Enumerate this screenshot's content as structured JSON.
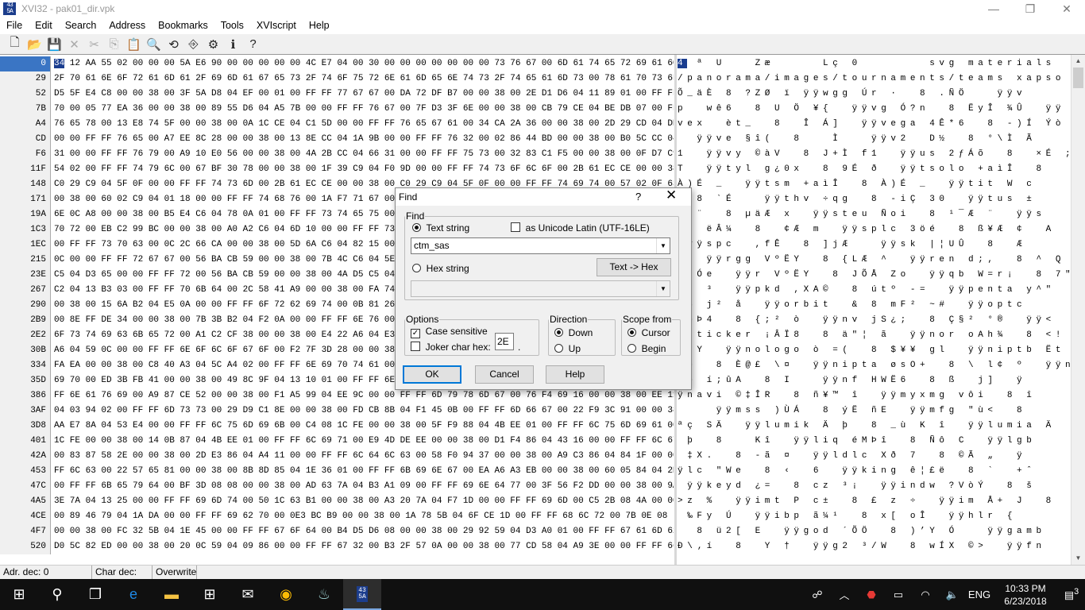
{
  "window": {
    "title": "XVI32 - pak01_dir.vpk",
    "icon_text": "4340\n5A5E\n4920",
    "minimize": "—",
    "restore": "❐",
    "close": "✕"
  },
  "menu": [
    "File",
    "Edit",
    "Search",
    "Address",
    "Bookmarks",
    "Tools",
    "XVIscript",
    "Help"
  ],
  "toolbar": [
    {
      "name": "new-file-icon",
      "glyph": "🗋"
    },
    {
      "name": "open-folder-icon",
      "glyph": "📂"
    },
    {
      "name": "save-icon",
      "glyph": "💾"
    },
    {
      "name": "close-file-icon",
      "glyph": "✕"
    },
    {
      "name": "cut-icon",
      "glyph": "✂"
    },
    {
      "name": "copy-icon",
      "glyph": "⎘"
    },
    {
      "name": "paste-icon",
      "glyph": "📋"
    },
    {
      "name": "find-icon",
      "glyph": "🔍"
    },
    {
      "name": "replace-icon",
      "glyph": "⟲"
    },
    {
      "name": "goto-icon",
      "glyph": "⎆"
    },
    {
      "name": "run-script-icon",
      "glyph": "⚙"
    },
    {
      "name": "about-icon",
      "glyph": "ℹ"
    },
    {
      "name": "context-help-icon",
      "glyph": "?"
    }
  ],
  "editor": {
    "addresses": [
      "0",
      "29",
      "52",
      "7B",
      "A4",
      "CD",
      "F6",
      "11F",
      "148",
      "171",
      "19A",
      "1C3",
      "1EC",
      "215",
      "23E",
      "267",
      "290",
      "2B9",
      "2E2",
      "30B",
      "334",
      "35D",
      "386",
      "3AF",
      "3D8",
      "401",
      "42A",
      "453",
      "47C",
      "4A5",
      "4CE",
      "4F7",
      "520"
    ],
    "hex_rows": [
      "34 12 AA 55 02 00 00 00 5A E6 90 00 00 00 00 00 4C E7 04 00 30 00 00 00 00 00 00 00 73 76 67 00 6D 61 74 65 72 69 61 6C 73",
      "2F 70 61 6E 6F 72 61 6D 61 2F 69 6D 61 67 65 73 2F 74 6F 75 72 6E 61 6D 65 6E 74 73 2F 74 65 61 6D 73 00 78 61 70 73 6F 00",
      "D5 5F E4 C8 00 00 38 00 3F 5A D8 04 EF 00 01 00 FF FF 77 67 67 00 DA 72 DF B7 00 00 38 00 2E D1 D6 04 11 89 01 00 FF FF 76",
      "70 00 05 77 EA 36 00 00 38 00 89 55 D6 04 A5 7B 00 00 FF FF 76 67 00 7F D3 3F 6E 00 00 38 00 CB 79 CE 04 BE DB 07 00 FF FF",
      "76 65 78 00 13 E8 74 5F 00 00 38 00 0A 1C CE 04 C1 5D 00 00 FF FF 76 65 67 61 00 34 CA 2A 36 00 00 38 00 2D 29 CD 04 DD F2",
      "00 00 FF FF 76 65 00 A7 EE 8C 28 00 00 38 00 13 8E CC 04 1A 9B 00 00 FF FF 76 32 00 02 86 44 BD 00 00 38 00 B0 5C CC 04 C3",
      "31 00 00 FF FF 76 79 00 A9 10 E0 56 00 00 38 00 4A 2B CC 04 66 31 00 00 FF FF 75 73 00 32 83 C1 F5 00 00 38 00 0F D7 C9 04 3B",
      "54 02 00 FF FF 74 79 6C 00 67 BF 30 78 00 00 38 00 1F 39 C9 04 F0 9D 00 00 FF FF 74 73 6F 6C 6F 00 2B 61 EC CE 00 00 38 00",
      "C0 29 C9 04 5F 0F 00 00 FF FF 74 73 6D 00 2B 61 EC CE 00 00 38 00 C0 29 C9 04 5F 0F 00 00 FF FF 74 69 74 00 57 02 0F 63 00",
      "00 38 00 60 02 C9 04 01 18 00 00 FF FF 74 68 76 00 1A F7 71 67 00 00 38 00 2D 69 C7 04 33 30 00 00 FF FF 74 75 73 00 B1 00",
      "6E 0C A8 00 00 38 00 B5 E4 C6 04 78 0A 01 00 FF FF 73 74 65 75 00 12 D1 6F 69 00 00 38 00 B9 AF C6 04 A8 1A 00 00 FF FF 73",
      "70 72 00 EB C2 99 BC 00 00 38 00 A0 A2 C6 04 6D 10 00 00 FF FF 73 70 6C 63 00 33 F6 E9 00 00 38 00 DF A5 C6 04 A2 00 00 41",
      "00 FF FF 73 70 63 00 0C 2C 66 CA 00 00 38 00 5D 6A C6 04 82 15 00 00 FF FF 73 6B 00 7C A6 55 DB 00 00 38 00 11 11 C6 04 95",
      "0C 00 00 FF FF 72 67 67 00 56 BA CB 59 00 00 38 00 7B 4C C6 04 5E 1A 00 00 FF FF 72 65 6E 00 64 3B 2C 00 00 38 00 5E 1E 51",
      "C5 04 D3 65 00 00 FF FF 72 00 56 BA CB 59 00 00 38 00 4A D5 C5 04 5A 6F 00 00 FF FF 71 62 00 57 3D 72 A1 00 00 38 00 37 22",
      "C2 04 13 B3 03 00 FF FF 70 6B 64 00 2C 58 41 A9 00 00 38 00 FA 74 BA 04 2D 3D 00 00 FF FF 70 65 6E 74 61 00 79 5E 22 00 00",
      "00 38 00 15 6A B2 04 E5 0A 00 00 FF FF 6F 72 62 69 74 00 0B 81 26 1D 00 00 38 00 6D 46 B2 04 7E 23 00 00 FF FF 6F 70 74 63",
      "00 8E FF DE 34 00 00 38 00 7B 3B B2 04 F2 0A 00 00 FF FF 6E 76 00 6A 53 BF 3B 00 00 38 00 C7 A7 B2 04 B0 AE 00 00 FF FF 3C",
      "6F 73 74 69 63 6B 65 72 00 A1 C2 CF 38 00 00 38 00 E4 22 A6 04 E3 9E 00 00 FF FF 6E 6F 72 00 6F 41 68 BE 00 00 38 00 3C 21",
      "A6 04 59 0C 00 00 FF FF 6E 6F 6C 6F 67 6F 00 F2 7F 3D 28 00 00 38 00 24 A5 A5 04 67 6C 00 00 FF FF 6E 69 70 74 62 00 CB 74",
      "FA EA 00 00 38 00 C8 40 A3 04 5C A4 02 00 FF FF 6E 69 70 74 61 00 F8 73 4F 2B 00 00 38 00 5C A0 6C A2 04 BA 00 00 FF FF 6E",
      "69 70 00 ED 3B FB 41 00 00 38 00 49 8C 9F 04 13 10 01 00 FF FF 6E 66 00 48 57 CB 36 00 00 38 00 DF 9A 9B 04 6A 5D 00 00 FF",
      "FF 6E 61 76 69 00 A9 87 CE 52 00 00 38 00 F1 A5 99 04 EE 9C 00 00 FF FF 6D 79 78 6D 67 00 76 F4 69 16 00 00 38 00 EE 11 97",
      "04 03 94 02 00 FF FF 6D 73 73 00 29 D9 C1 8E 00 00 38 00 FD CB 8B 04 F1 45 0B 00 FF FF 6D 66 67 00 22 F9 3C 91 00 00 38 00",
      "AA E7 8A 04 53 E4 00 00 FF FF 6C 75 6D 69 6B 00 C4 08 1C FE 00 00 38 00 5F F9 88 04 4B EE 01 00 FF FF 6C 75 6D 69 61 00 C4 08",
      "1C FE 00 00 38 00 14 0B 87 04 4B EE 01 00 FF FF 6C 69 71 00 E9 4D DE EE 00 00 38 00 D1 F4 86 04 43 16 00 00 FF FF 6C 67 62",
      "00 83 87 58 2E 00 00 38 00 2D E3 86 04 A4 11 00 00 FF FF 6C 64 6C 63 00 58 F0 94 37 00 00 38 00 A9 C3 86 04 84 1F 00 00 FF",
      "FF 6C 63 00 22 57 65 81 00 00 38 00 8B 8D 85 04 1E 36 01 00 FF FF 6B 69 6E 67 00 EA A6 A3 EB 00 00 38 00 60 05 84 04 2B 88",
      "00 FF FF 6B 65 79 64 00 BF 3D 08 08 00 00 38 00 AD 63 7A 04 B3 A1 09 00 FF FF 69 6E 64 77 00 3F 56 F2 DD 00 00 38 00 9A",
      "3E 7A 04 13 25 00 00 FF FF 69 6D 74 00 50 1C 63 B1 00 00 38 00 A3 20 7A 04 F7 1D 00 00 FF FF 69 6D 00 C5 2B 08 4A 00 00 38",
      "00 89 46 79 04 1A DA 00 00 FF FF 69 62 70 00 0E3 BC B9 00 00 38 00 1A 78 5B 04 6F CE 1D 00 FF FF 68 6C 72 00 7B 0E 08",
      "00 00 38 00 FC 32 5B 04 1E 45 00 00 FF FF 67 6F 64 00 B4 D5 D6 08 00 00 38 00 29 92 59 04 D3 A0 01 00 FF FF 67 61 6D 62 00",
      "D0 5C 82 ED 00 00 38 00 20 0C 59 04 09 86 00 00 FF FF 67 32 00 B3 2F 57 0A 00 00 38 00 77 CD 58 04 A9 3E 00 00 FF FF 66 6E"
    ],
    "text_rows": [
      "4 ª U   Zæ     Lç 0       svg materials",
      "/panorama/images/tournaments/teams xapso",
      "Õ_äÈ 8 ?ZØ ï ÿÿwgg Úr ·  8 .ÑÖ   ÿÿv",
      "p  wê6  8 U Ö ¥{  ÿÿvg Ó?n  8 ËyÎ ¾Û  ÿÿ",
      "vex  èt_  8  Î Á]  ÿÿvega 4Ê*6  8 -)Í Ýò",
      "  ÿÿve §î(  8   Ì   ÿÿv2  D½  8 °\\Ì Ã",
      "1  ÿÿvy ©àV  8 J+Ì f1  ÿÿus 2ƒÁõ  8  ×É ;",
      "T  ÿÿtyl g¿0x  8 9É ð  ÿÿtsolo +aìÎ  8",
      "À)É _  ÿÿtsm +aìÎ  8 À)É _  ÿÿtit W c",
      "  8 `É   ÿÿthv ÷qg  8 -iÇ 30  ÿÿtus ±",
      "n ¨  8 µäÆ x  ÿÿsteu Ñoi  8 ¹¯Æ ¨  ÿÿs",
      "pr ëÂ¼  8  ¢Æ m  ÿÿsplc 3öé  8 ß¥Æ ¢  A",
      " ÿÿspc  ,fÊ  8 ]jÆ   ÿÿsk |¦UÛ  8  Æ ",
      "   ÿÿrgg VºËY  8 {LÆ ^  ÿÿren d;,  8 ^ Q",
      "Å Óe  ÿÿr VºËY  8 JÕÅ Zo  ÿÿqb W=r¡  8 7\"",
      "Â  ³  ÿÿpkd ,XA©  8 útº -=  ÿÿpenta y^\"",
      " 8 j² å  ÿÿorbit  & 8 mF² ~#  ÿÿoptc",
      " þÞ4  8 {;² ò  ÿÿnv jS¿;  8 Ç§² °®  ÿÿ<",
      "osticker ¡ÂÏ8  8 ä\"¦ ã  ÿÿnor oAh¾  8 <!",
      "¦ Y  ÿÿnologo ò =(  8 $¥¥ gl  ÿÿniptb Ët",
      "úê  8 È@£ \\¤  ÿÿnipta øsO+  8 \\ l¢ º  ÿÿn",
      "ip í;ûA  8 I   ÿÿnf HWË6  8 ß  j]  ÿ",
      "ÿnavi ©‡ÎR  8 ñ¥™ î  ÿÿmyxmg vôi  8 î ",
      "    ÿÿmss )ÙÁ  8 ýË ñE  ÿÿmfg \"ù<  8",
      "ªç SÄ  ÿÿlumik Ä þ  8 _ù K î  ÿÿlumia Ä",
      " þ  8   Kî  ÿÿliq éMÞî  8 Ñô C  ÿÿlgb",
      " ‡X.  8 -ã ¤  ÿÿldlc Xð 7  8 ©Ã „  ÿ",
      "ÿlc \"We  8 ‹  6  ÿÿking ê¦£ë  8 `  +ˆ",
      " ÿÿkeyd ¿=  8 ­cz ³¡  ÿÿindw ?VòÝ  8 š",
      ">z %  ÿÿimt P c±  8 £ z ÷  ÿÿim Å+ J  8",
      " ‰Fy Ú  ÿÿibp ã¼¹  8 x[ oÎ  ÿÿhlr {  ",
      "  8 ü2[ E  ÿÿgod ´ÕÖ  8 )’Y Ó   ÿÿgamb",
      "Ð\\‚í  8  Y †  ÿÿg2 ³/W  8 wÍX ©>  ÿÿfn"
    ]
  },
  "status": {
    "addr": "Adr. dec: 0",
    "char": "Char dec: 52",
    "mode": "Overwrite"
  },
  "find_dialog": {
    "title": "Find",
    "help_glyph": "?",
    "close_glyph": "✕",
    "find_group": "Find",
    "text_string_label": "Text string",
    "unicode_label": "as Unicode Latin (UTF-16LE)",
    "search_value": "ctm_sas",
    "text_to_hex": "Text -> Hex",
    "hex_string_label": "Hex string",
    "hex_value": "",
    "options_group": "Options",
    "case_sensitive": "Case sensitive",
    "joker_label": "Joker char hex:",
    "joker_value": "2E",
    "joker_suffix": ".",
    "direction_group": "Direction",
    "down": "Down",
    "up": "Up",
    "scope_group": "Scope from",
    "cursor": "Cursor",
    "begin": "Begin",
    "ok": "OK",
    "cancel": "Cancel",
    "help": "Help"
  },
  "taskbar": {
    "lang": "ENG",
    "time": "10:33 PM",
    "date": "6/23/2018",
    "notif_count": "3"
  }
}
